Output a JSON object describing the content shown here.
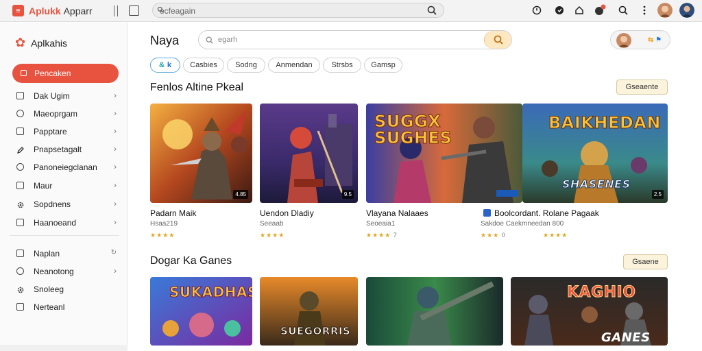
{
  "topbar": {
    "logo_letter": "≡",
    "title_part1": "Aplukk",
    "title_part2": "Apparr",
    "search_placeholder": "ecfeagain"
  },
  "sidebar": {
    "brand": "Aplkahis",
    "active": "Pencaken",
    "items": [
      {
        "label": "Dak Ugim",
        "icon": "box-icon"
      },
      {
        "label": "Maeoprgam",
        "icon": "clock-icon"
      },
      {
        "label": "Papptare",
        "icon": "grid-icon"
      },
      {
        "label": "Pnapsetagalt",
        "icon": "pencil-icon"
      },
      {
        "label": "Panoneiegclanan",
        "icon": "circle-icon"
      },
      {
        "label": "Maur",
        "icon": "box-icon"
      },
      {
        "label": "Sopdnens",
        "icon": "gear-icon"
      },
      {
        "label": "Haanoeand",
        "icon": "checkbox-icon"
      }
    ],
    "items2": [
      {
        "label": "Naplan",
        "icon": "doc-icon"
      },
      {
        "label": "Neanotong",
        "icon": "clock-icon"
      },
      {
        "label": "Snoleeg",
        "icon": "gear-icon"
      },
      {
        "label": "Nerteanl",
        "icon": "box-icon"
      }
    ]
  },
  "main": {
    "title": "Naya",
    "search_placeholder": "egarh",
    "chips": [
      "k",
      "Casbies",
      "Sodng",
      "Anmendan",
      "Strsbs",
      "Gamsp"
    ],
    "section1": {
      "title": "Fenlos Altine Pkeal",
      "button": "Gseaente",
      "cards": [
        {
          "title": "Padarn Maik",
          "sub": "Hsaa219",
          "stars": "★★★★",
          "num": "",
          "badge": "4.85"
        },
        {
          "title": "Uendon Dladiy",
          "sub": "Seeaab",
          "stars": "★★★★",
          "num": "",
          "badge": "9.5"
        },
        {
          "title": "Vlayana Nalaaes",
          "sub": "Seoeaia1",
          "stars": "★★★★",
          "num": "7",
          "badge": "",
          "art_text": "SUGGX SUGHES"
        },
        {
          "title": "Boolcordant. Rolane Pagaak",
          "sub": "Sakdoe Caekmneedan 800",
          "stars": "★★★",
          "num": "0",
          "stars2": "★★★★",
          "badge": "2.5",
          "art_text": "BAIKHEDAN",
          "art_text2": "SHASENES"
        }
      ]
    },
    "section2": {
      "title": "Dogar Ka Ganes",
      "button": "Gsaene",
      "cards": [
        {
          "art_text": "SUKADHAS"
        },
        {
          "art_text": "SUEGORRIS"
        },
        {
          "art_text": ""
        },
        {
          "art_text": "KAGHIO",
          "art_text2": "GANES"
        }
      ]
    }
  },
  "colors": {
    "accent": "#e8533f",
    "star": "#e3a21a",
    "chip_active": "#5aa9d6"
  }
}
